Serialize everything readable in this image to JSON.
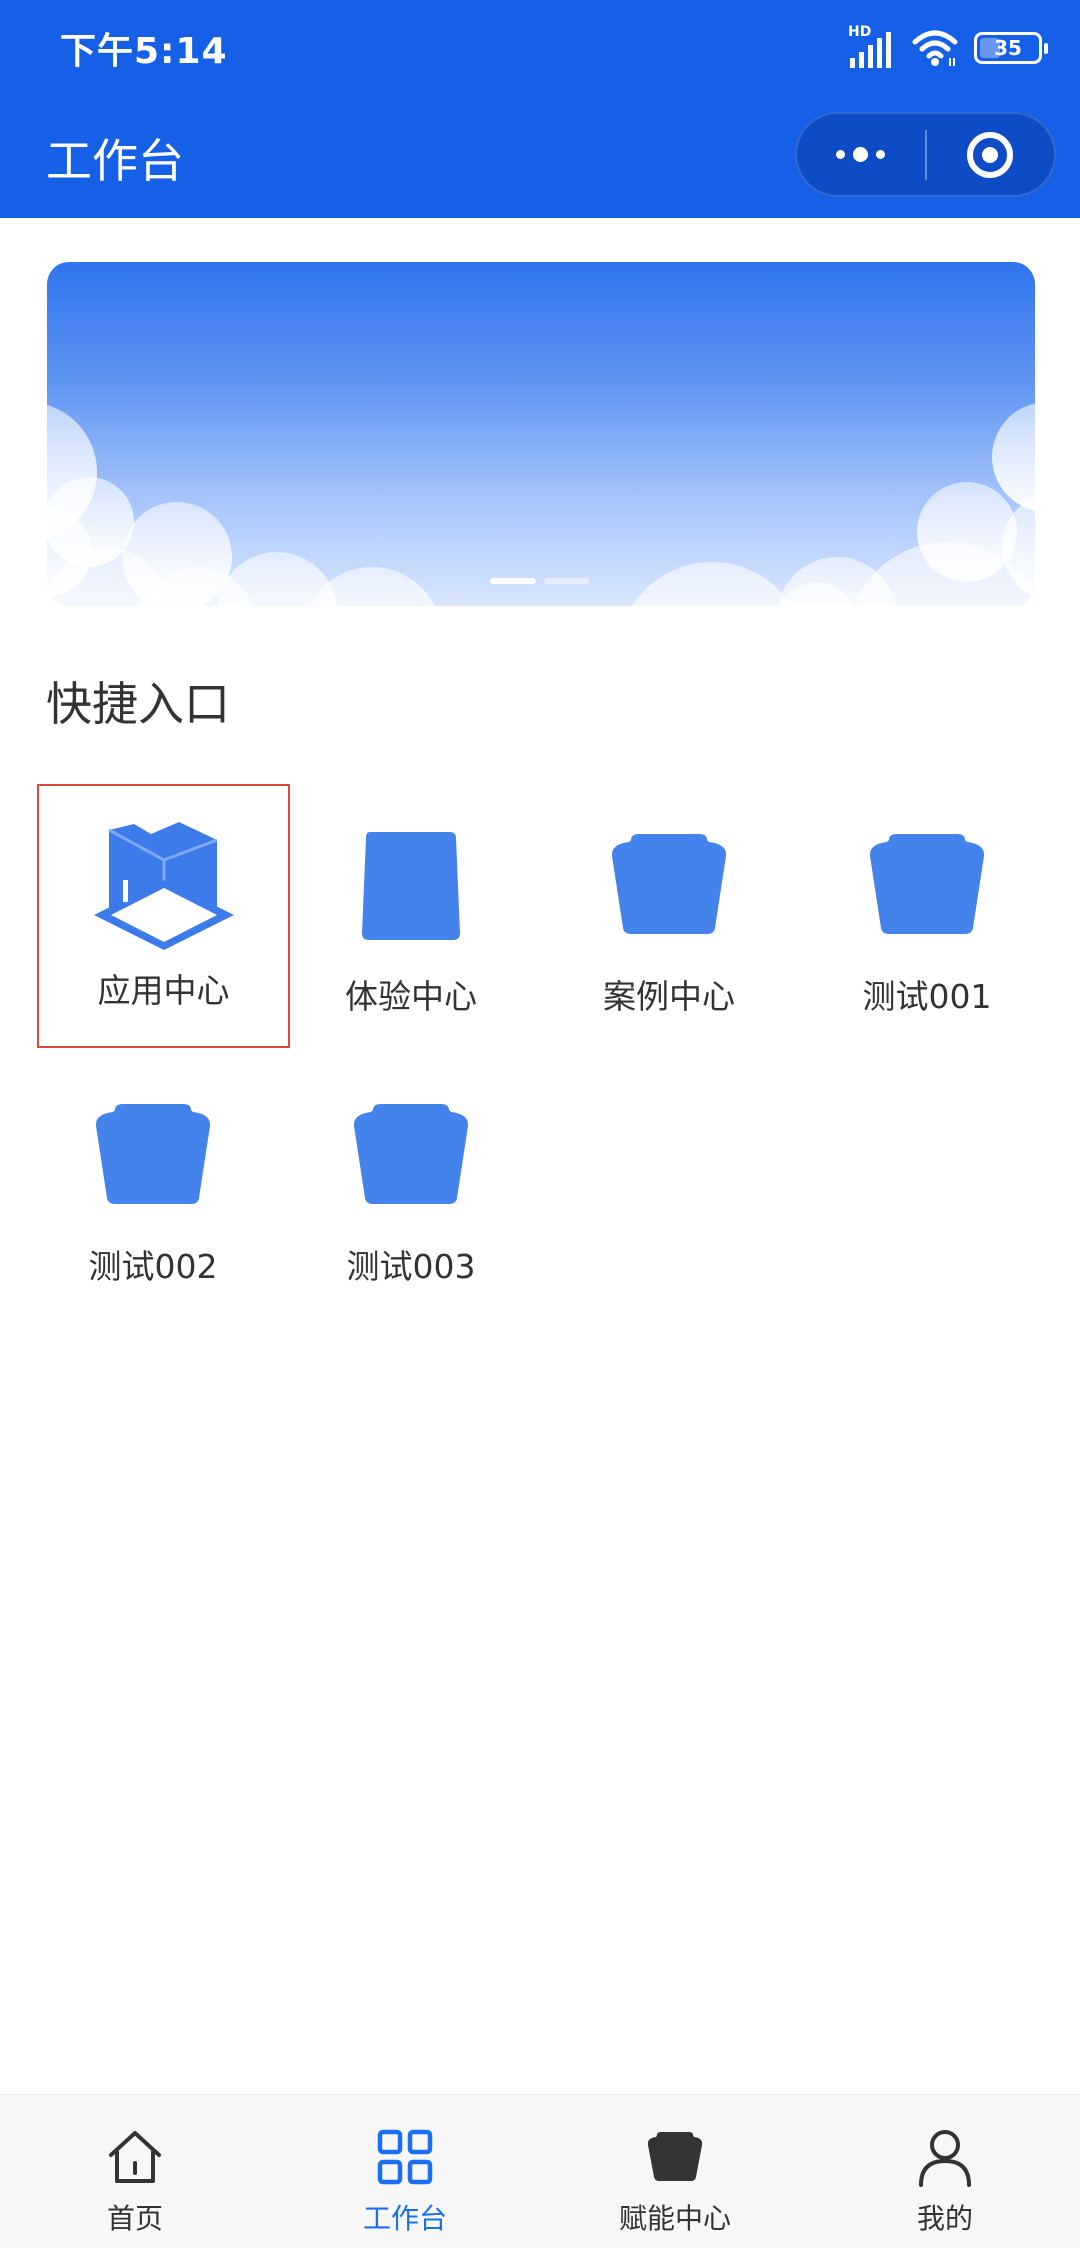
{
  "status_bar": {
    "time": "下午5:14",
    "network_label": "HD",
    "battery_level": "35",
    "battery_percent": 35,
    "icons": [
      "signal-icon",
      "wifi-icon",
      "battery-icon"
    ]
  },
  "nav": {
    "title": "工作台",
    "capsule": [
      "more-dots-icon",
      "close-target-icon"
    ]
  },
  "banner": {
    "slide_count": 2,
    "active_slide": 0,
    "colors": {
      "top": "#2f74ee",
      "bottom": "#d9e6fe"
    }
  },
  "quick_entry": {
    "title": "快捷入口",
    "items": [
      {
        "label": "应用中心",
        "icon": "app-center-icon",
        "selected": true
      },
      {
        "label": "体验中心",
        "icon": "folder-icon"
      },
      {
        "label": "案例中心",
        "icon": "folder-icon"
      },
      {
        "label": "测试001",
        "icon": "folder-icon"
      },
      {
        "label": "测试002",
        "icon": "folder-icon"
      },
      {
        "label": "测试003",
        "icon": "folder-icon"
      }
    ]
  },
  "tabbar": {
    "items": [
      {
        "label": "首页",
        "icon": "home-icon"
      },
      {
        "label": "工作台",
        "icon": "grid-icon",
        "active": true
      },
      {
        "label": "赋能中心",
        "icon": "empower-folder-icon"
      },
      {
        "label": "我的",
        "icon": "user-icon"
      }
    ]
  },
  "colors": {
    "brand": "#1660e8",
    "accent": "#1a6ff0",
    "icon_blue": "#4583ec",
    "selection_border": "#e2453c"
  }
}
